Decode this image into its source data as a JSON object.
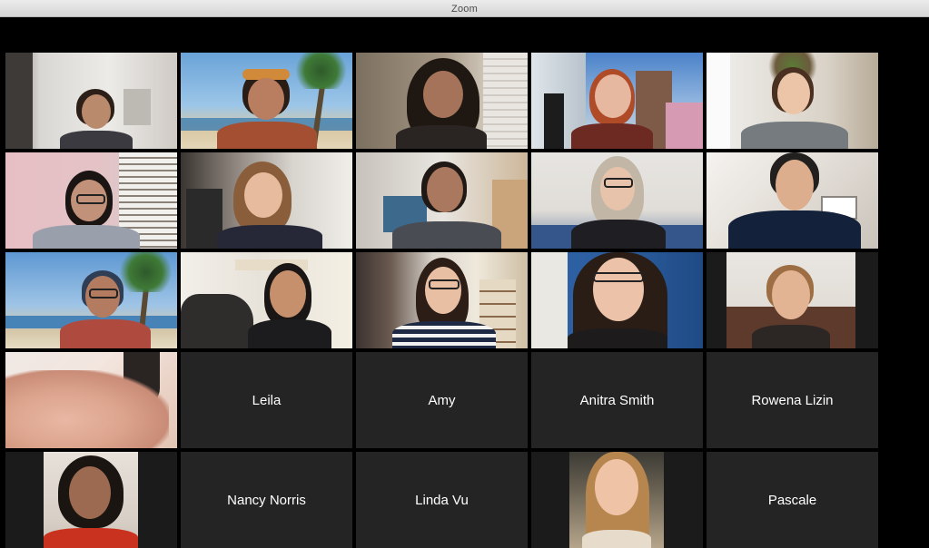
{
  "window": {
    "title": "Zoom"
  },
  "participants_with_names": {
    "leila": "Leila",
    "amy": "Amy",
    "anitra": "Anitra Smith",
    "rowena": "Rowena Lizin",
    "nancy": "Nancy Norris",
    "linda": "Linda Vu",
    "pascale": "Pascale"
  }
}
